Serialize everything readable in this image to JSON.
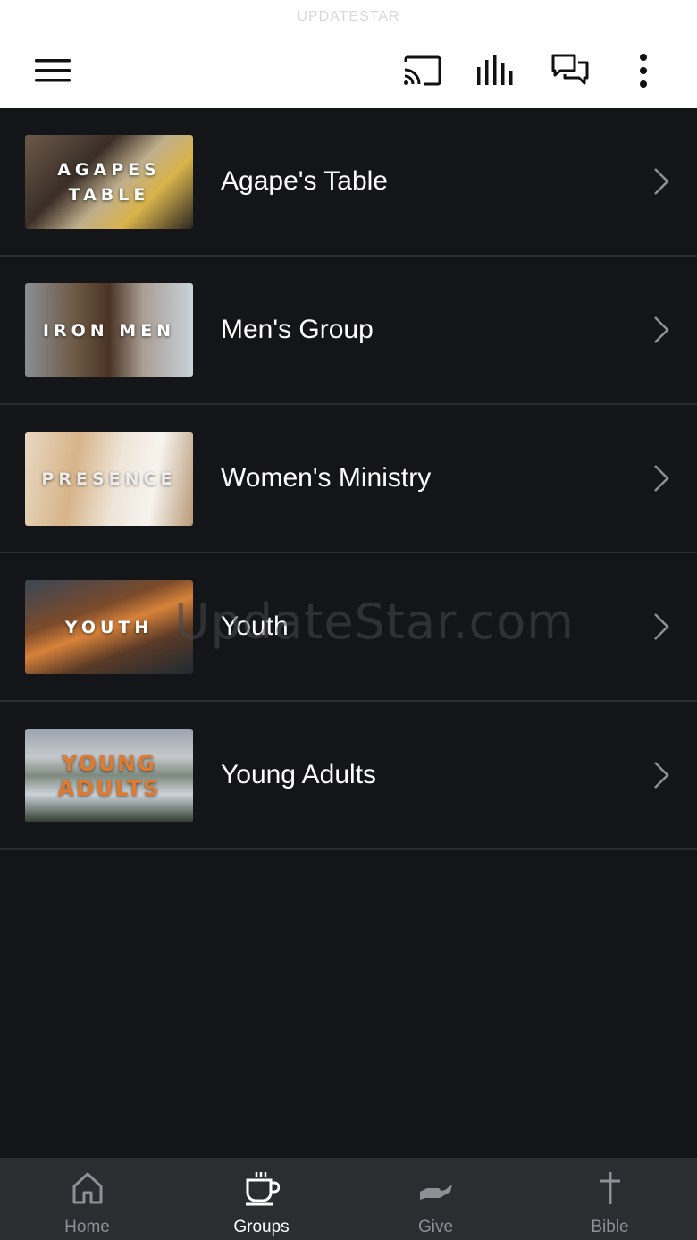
{
  "status_bar": {
    "text": "UPDATESTAR"
  },
  "header": {
    "menu_icon": "hamburger-icon",
    "actions": [
      {
        "name": "cast-icon"
      },
      {
        "name": "audio-bars-icon"
      },
      {
        "name": "chat-icon"
      },
      {
        "name": "more-vertical-icon"
      }
    ]
  },
  "groups": [
    {
      "title": "Agape's Table",
      "thumb_text": "AGAPES TABLE"
    },
    {
      "title": "Men's Group",
      "thumb_text": "IRON MEN"
    },
    {
      "title": "Women's Ministry",
      "thumb_text": "PRESENCE"
    },
    {
      "title": "Youth",
      "thumb_text": "YOUTH"
    },
    {
      "title": "Young Adults",
      "thumb_text": "YOUNG ADULTS"
    }
  ],
  "watermark": "UpdateStar.com",
  "bottom_nav": {
    "items": [
      {
        "label": "Home",
        "icon": "home-icon",
        "active": false
      },
      {
        "label": "Groups",
        "icon": "coffee-cup-icon",
        "active": true
      },
      {
        "label": "Give",
        "icon": "give-hand-icon",
        "active": false
      },
      {
        "label": "Bible",
        "icon": "cross-icon",
        "active": false
      }
    ]
  },
  "colors": {
    "background": "#141518",
    "header": "#ffffff",
    "nav_bg": "#2b2d31",
    "nav_inactive": "#8e9096",
    "nav_active": "#ffffff"
  }
}
